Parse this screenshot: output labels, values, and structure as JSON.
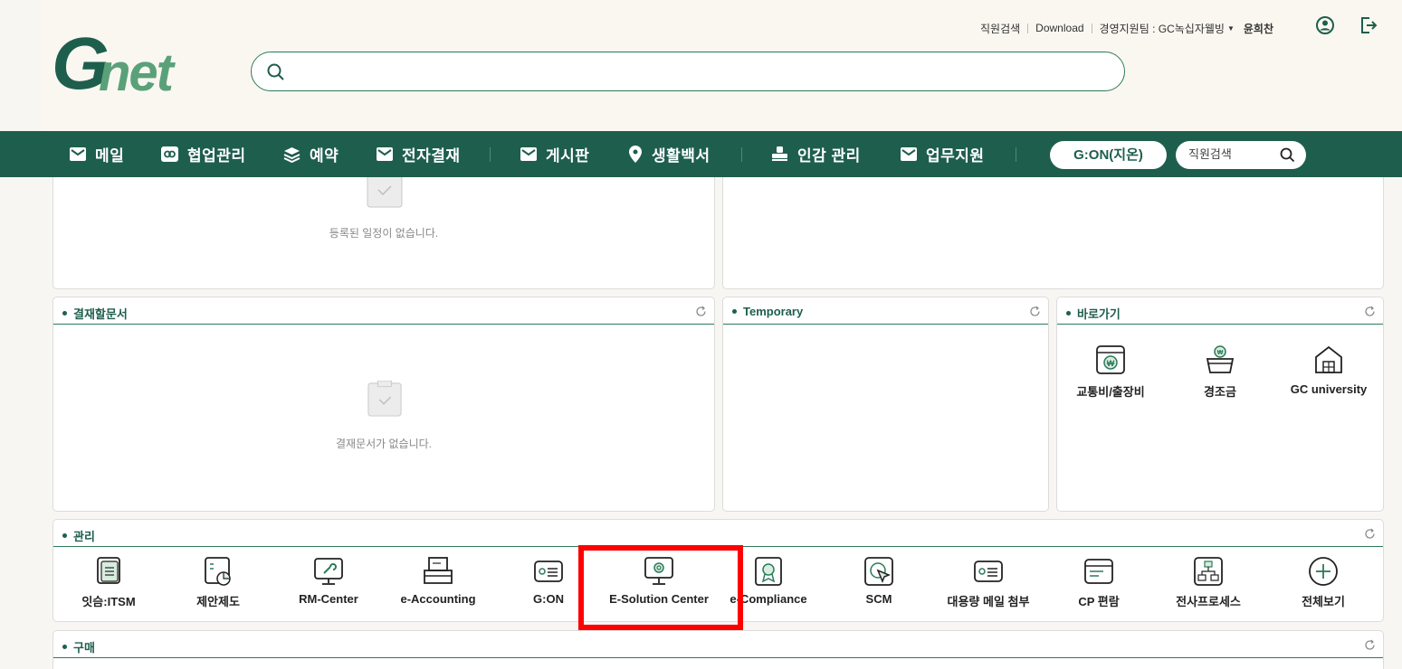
{
  "header": {
    "logo_text": "Gnet",
    "search_placeholder": "",
    "links": {
      "employee_search": "직원검색",
      "download": "Download",
      "department": "경영지원팀 : GC녹십자웰빙",
      "user": "윤희찬"
    }
  },
  "nav": {
    "items": [
      {
        "label": "메일",
        "icon": "mail-icon"
      },
      {
        "label": "협업관리",
        "icon": "collab-icon"
      },
      {
        "label": "예약",
        "icon": "reservation-icon"
      },
      {
        "label": "전자결재",
        "icon": "mail-icon"
      },
      {
        "label": "게시판",
        "icon": "mail-icon"
      },
      {
        "label": "생활백서",
        "icon": "location-pin-icon"
      },
      {
        "label": "인감 관리",
        "icon": "stamp-icon"
      },
      {
        "label": "업무지원",
        "icon": "mail-icon"
      }
    ],
    "gon_button": "G:ON(지온)",
    "search_placeholder": "직원검색"
  },
  "schedule": {
    "empty": "등록된 일정이 없습니다."
  },
  "approval": {
    "title": "결재할문서",
    "empty": "결재문서가 없습니다."
  },
  "temporary": {
    "title": "Temporary"
  },
  "shortcuts": {
    "title": "바로가기",
    "items": [
      {
        "label": "교통비/출장비",
        "icon": "money-icon"
      },
      {
        "label": "경조금",
        "icon": "gift-basket-icon"
      },
      {
        "label": "GC university",
        "icon": "building-icon"
      }
    ]
  },
  "management": {
    "title": "관리",
    "items": [
      {
        "label": "잇슴:ITSM",
        "icon": "document-stack-icon"
      },
      {
        "label": "제안제도",
        "icon": "proposal-chart-icon"
      },
      {
        "label": "RM-Center",
        "icon": "monitor-wrench-icon"
      },
      {
        "label": "e-Accounting",
        "icon": "printer-icon"
      },
      {
        "label": "G:ON",
        "icon": "id-card-icon"
      },
      {
        "label": "E-Solution Center",
        "icon": "monitor-gear-icon"
      },
      {
        "label": "e-Compliance",
        "icon": "certificate-icon"
      },
      {
        "label": "SCM",
        "icon": "cursor-click-icon"
      },
      {
        "label": "대용량 메일 첨부",
        "icon": "id-card-icon"
      },
      {
        "label": "CP 편람",
        "icon": "card-icon"
      },
      {
        "label": "전사프로세스",
        "icon": "org-chart-icon"
      },
      {
        "label": "전체보기",
        "icon": "plus-circle-icon"
      }
    ]
  },
  "purchase": {
    "title": "구매"
  },
  "colors": {
    "brand_green": "#1e5e4d",
    "accent_green": "#2d7a5a",
    "highlight": "#ff0000"
  }
}
